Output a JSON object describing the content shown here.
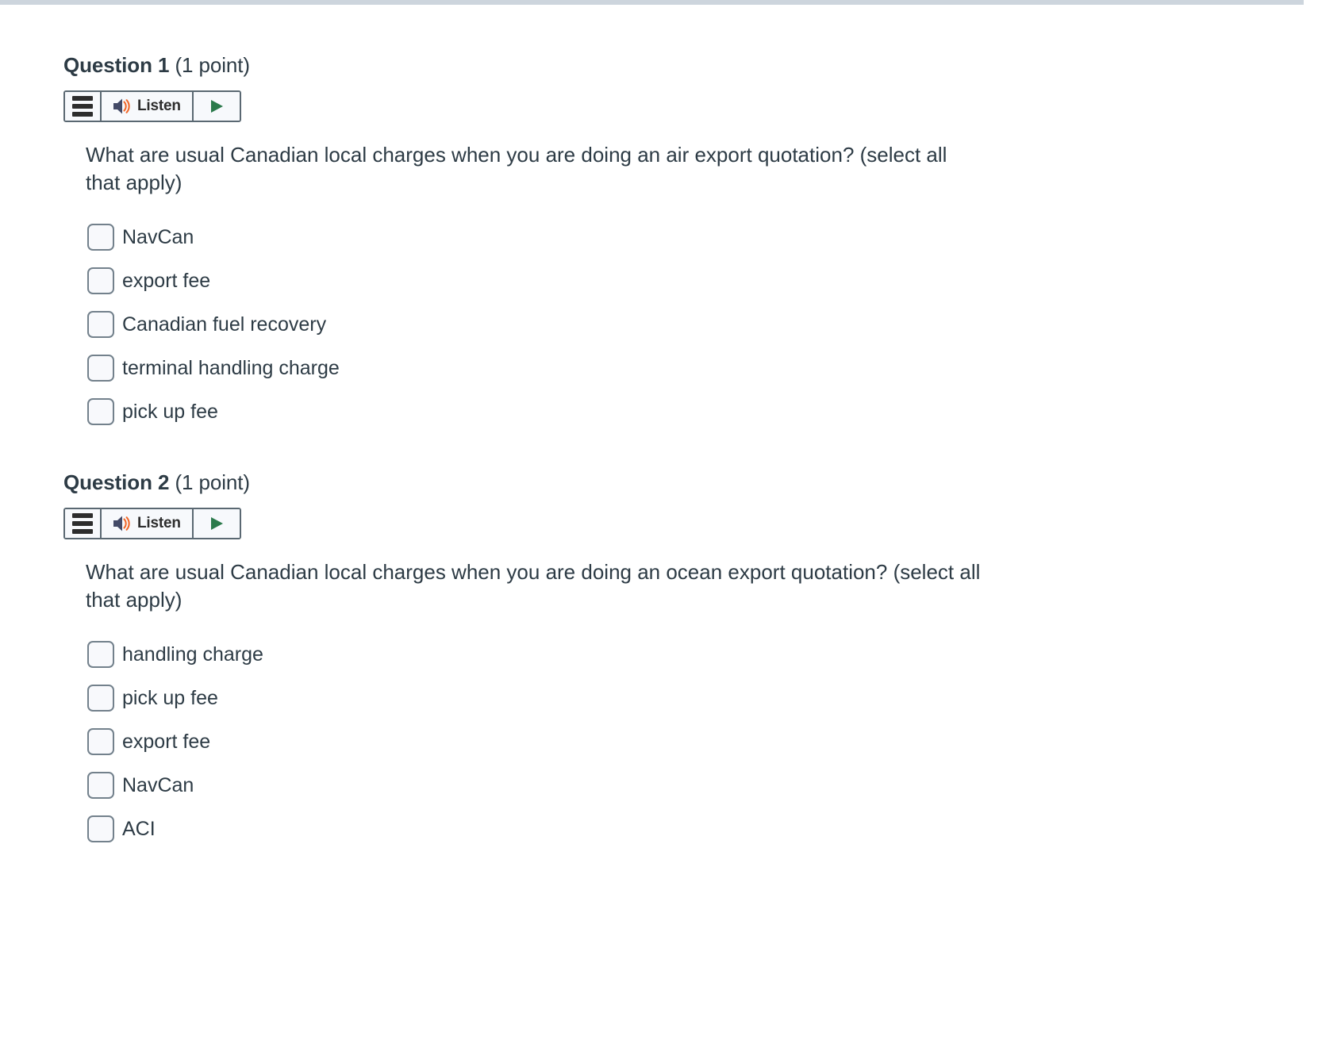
{
  "theme": {
    "top_rule_color": "#cdd5dd",
    "text_color": "#2d3b45",
    "toolbar_border_color": "#5a6872",
    "toolbar_bg_color": "#f7f9fc",
    "speaker_icon_color": "#434a67",
    "soundwave_icon_color": "#f2682a",
    "play_icon_color": "#2b7a4b",
    "hamburger_icon_color": "#2d2d2d",
    "checkbox_border_color": "#73818c",
    "checkbox_fill_color": "#f8f9fc"
  },
  "questions": [
    {
      "name": "Question 1",
      "points": "(1 point)",
      "listen": {
        "label": "Listen",
        "menu_icon": "hamburger-icon",
        "speaker_icon": "speaker-icon",
        "play_icon": "play-icon"
      },
      "prompt": "What are usual Canadian local charges when you are doing an air export quotation? (select all that apply)",
      "options": [
        {
          "label": "NavCan",
          "checked": false
        },
        {
          "label": "export fee",
          "checked": false
        },
        {
          "label": "Canadian fuel recovery",
          "checked": false
        },
        {
          "label": "terminal handling charge",
          "checked": false
        },
        {
          "label": "pick up fee",
          "checked": false
        }
      ]
    },
    {
      "name": "Question 2",
      "points": "(1 point)",
      "listen": {
        "label": "Listen",
        "menu_icon": "hamburger-icon",
        "speaker_icon": "speaker-icon",
        "play_icon": "play-icon"
      },
      "prompt": "What are usual Canadian local charges when you are doing an ocean export quotation? (select all that apply)",
      "options": [
        {
          "label": "handling charge",
          "checked": false
        },
        {
          "label": "pick up fee",
          "checked": false
        },
        {
          "label": "export fee",
          "checked": false
        },
        {
          "label": "NavCan",
          "checked": false
        },
        {
          "label": "ACI",
          "checked": false
        }
      ]
    }
  ]
}
